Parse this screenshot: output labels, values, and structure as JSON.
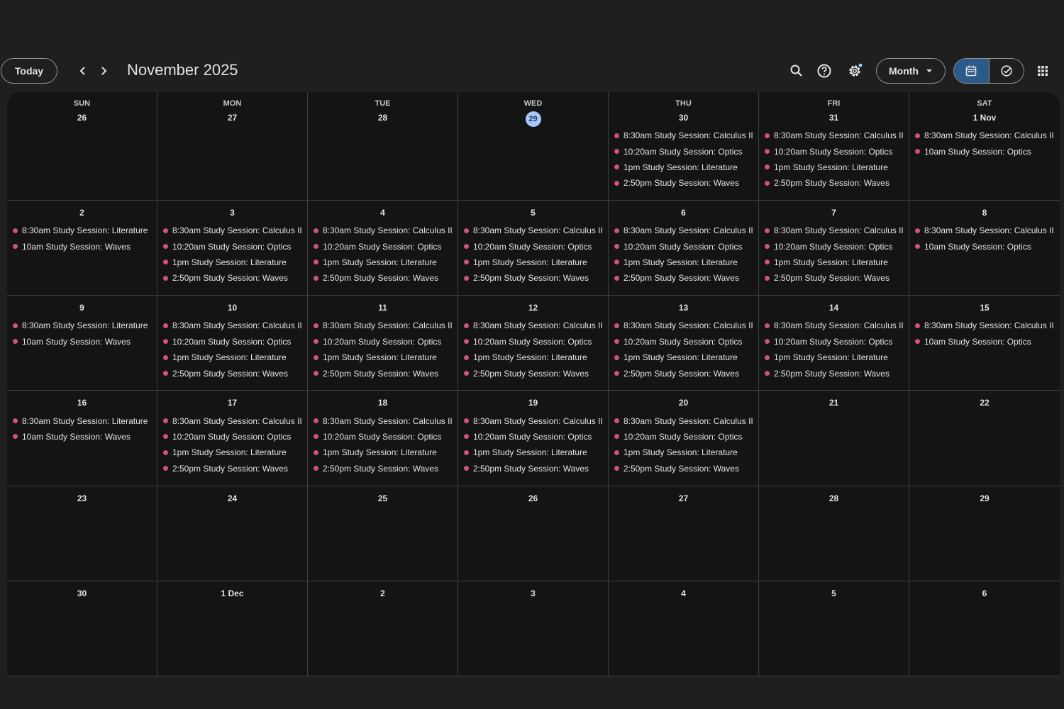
{
  "toolbar": {
    "today_label": "Today",
    "title": "November 2025",
    "view_label": "Month",
    "accent_color": "#a8c7fa",
    "event_color": "#d0537a"
  },
  "weekdays": [
    "SUN",
    "MON",
    "TUE",
    "WED",
    "THU",
    "FRI",
    "SAT"
  ],
  "weeks": [
    [
      {
        "day": "26",
        "events": []
      },
      {
        "day": "27",
        "events": []
      },
      {
        "day": "28",
        "events": []
      },
      {
        "day": "29",
        "today": true,
        "events": []
      },
      {
        "day": "30",
        "events": [
          "8:30am Study Session: Calculus II",
          "10:20am Study Session: Optics",
          "1pm Study Session: Literature",
          "2:50pm Study Session: Waves"
        ]
      },
      {
        "day": "31",
        "events": [
          "8:30am Study Session: Calculus II",
          "10:20am Study Session: Optics",
          "1pm Study Session: Literature",
          "2:50pm Study Session: Waves"
        ]
      },
      {
        "day": "1 Nov",
        "events": [
          "8:30am Study Session: Calculus II",
          "10am Study Session: Optics"
        ]
      }
    ],
    [
      {
        "day": "2",
        "events": [
          "8:30am Study Session: Literature",
          "10am Study Session: Waves"
        ]
      },
      {
        "day": "3",
        "events": [
          "8:30am Study Session: Calculus II",
          "10:20am Study Session: Optics",
          "1pm Study Session: Literature",
          "2:50pm Study Session: Waves"
        ]
      },
      {
        "day": "4",
        "events": [
          "8:30am Study Session: Calculus II",
          "10:20am Study Session: Optics",
          "1pm Study Session: Literature",
          "2:50pm Study Session: Waves"
        ]
      },
      {
        "day": "5",
        "events": [
          "8:30am Study Session: Calculus II",
          "10:20am Study Session: Optics",
          "1pm Study Session: Literature",
          "2:50pm Study Session: Waves"
        ]
      },
      {
        "day": "6",
        "events": [
          "8:30am Study Session: Calculus II",
          "10:20am Study Session: Optics",
          "1pm Study Session: Literature",
          "2:50pm Study Session: Waves"
        ]
      },
      {
        "day": "7",
        "events": [
          "8:30am Study Session: Calculus II",
          "10:20am Study Session: Optics",
          "1pm Study Session: Literature",
          "2:50pm Study Session: Waves"
        ]
      },
      {
        "day": "8",
        "events": [
          "8:30am Study Session: Calculus II",
          "10am Study Session: Optics"
        ]
      }
    ],
    [
      {
        "day": "9",
        "events": [
          "8:30am Study Session: Literature",
          "10am Study Session: Waves"
        ]
      },
      {
        "day": "10",
        "events": [
          "8:30am Study Session: Calculus II",
          "10:20am Study Session: Optics",
          "1pm Study Session: Literature",
          "2:50pm Study Session: Waves"
        ]
      },
      {
        "day": "11",
        "events": [
          "8:30am Study Session: Calculus II",
          "10:20am Study Session: Optics",
          "1pm Study Session: Literature",
          "2:50pm Study Session: Waves"
        ]
      },
      {
        "day": "12",
        "events": [
          "8:30am Study Session: Calculus II",
          "10:20am Study Session: Optics",
          "1pm Study Session: Literature",
          "2:50pm Study Session: Waves"
        ]
      },
      {
        "day": "13",
        "events": [
          "8:30am Study Session: Calculus II",
          "10:20am Study Session: Optics",
          "1pm Study Session: Literature",
          "2:50pm Study Session: Waves"
        ]
      },
      {
        "day": "14",
        "events": [
          "8:30am Study Session: Calculus II",
          "10:20am Study Session: Optics",
          "1pm Study Session: Literature",
          "2:50pm Study Session: Waves"
        ]
      },
      {
        "day": "15",
        "events": [
          "8:30am Study Session: Calculus II",
          "10am Study Session: Optics"
        ]
      }
    ],
    [
      {
        "day": "16",
        "events": [
          "8:30am Study Session: Literature",
          "10am Study Session: Waves"
        ]
      },
      {
        "day": "17",
        "events": [
          "8:30am Study Session: Calculus II",
          "10:20am Study Session: Optics",
          "1pm Study Session: Literature",
          "2:50pm Study Session: Waves"
        ]
      },
      {
        "day": "18",
        "events": [
          "8:30am Study Session: Calculus II",
          "10:20am Study Session: Optics",
          "1pm Study Session: Literature",
          "2:50pm Study Session: Waves"
        ]
      },
      {
        "day": "19",
        "events": [
          "8:30am Study Session: Calculus II",
          "10:20am Study Session: Optics",
          "1pm Study Session: Literature",
          "2:50pm Study Session: Waves"
        ]
      },
      {
        "day": "20",
        "events": [
          "8:30am Study Session: Calculus II",
          "10:20am Study Session: Optics",
          "1pm Study Session: Literature",
          "2:50pm Study Session: Waves"
        ]
      },
      {
        "day": "21",
        "events": []
      },
      {
        "day": "22",
        "events": []
      }
    ],
    [
      {
        "day": "23",
        "events": []
      },
      {
        "day": "24",
        "events": []
      },
      {
        "day": "25",
        "events": []
      },
      {
        "day": "26",
        "events": []
      },
      {
        "day": "27",
        "events": []
      },
      {
        "day": "28",
        "events": []
      },
      {
        "day": "29",
        "events": []
      }
    ],
    [
      {
        "day": "30",
        "events": []
      },
      {
        "day": "1 Dec",
        "events": []
      },
      {
        "day": "2",
        "events": []
      },
      {
        "day": "3",
        "events": []
      },
      {
        "day": "4",
        "events": []
      },
      {
        "day": "5",
        "events": []
      },
      {
        "day": "6",
        "events": []
      }
    ]
  ]
}
